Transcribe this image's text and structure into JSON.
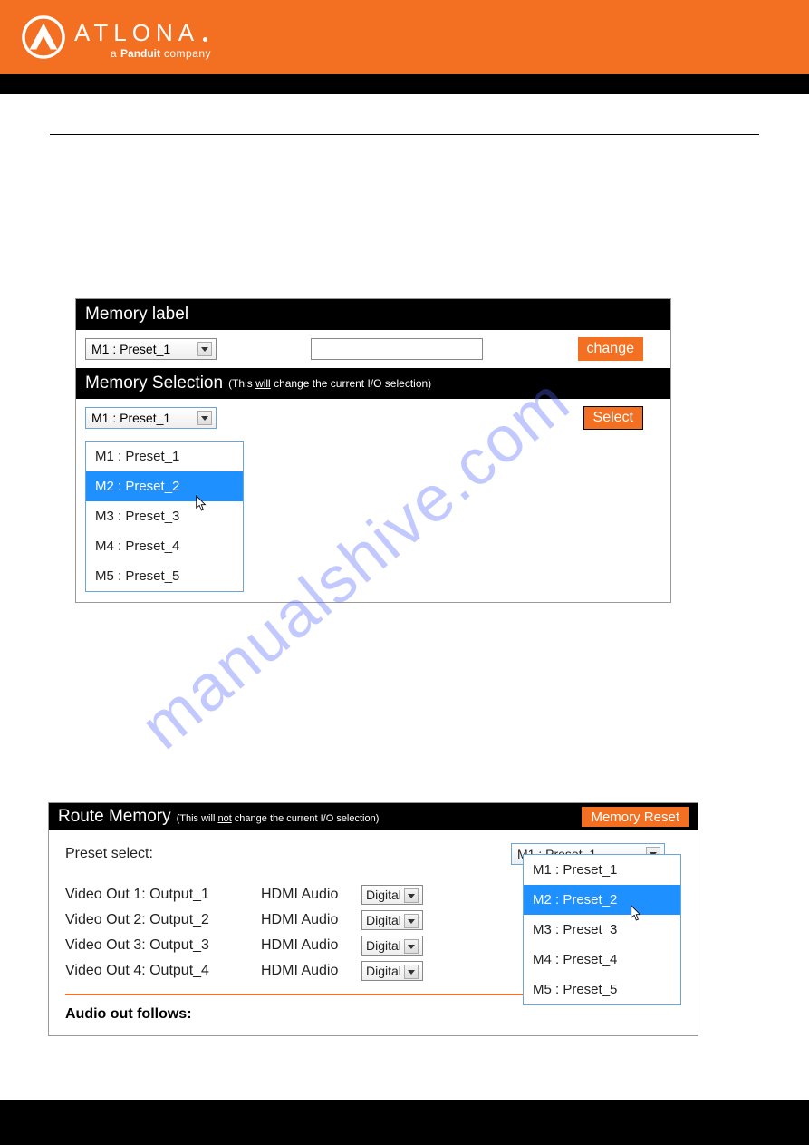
{
  "brand": {
    "name": "ATLONA",
    "tagline_prefix": "a ",
    "tagline_bold": "Panduit",
    "tagline_suffix": " company"
  },
  "watermark": "manualshive.com",
  "panel1": {
    "memory_label_title": "Memory label",
    "memory_label_selected": "M1 : Preset_1",
    "change_btn": "change",
    "memory_selection_title": "Memory Selection",
    "memory_selection_note_before": "(This ",
    "memory_selection_note_underline": "will",
    "memory_selection_note_after": " change the current I/O selection)",
    "memory_selection_selected": "M1 : Preset_1",
    "select_btn": "Select",
    "options": [
      "M1 : Preset_1",
      "M2 : Preset_2",
      "M3 : Preset_3",
      "M4 : Preset_4",
      "M5 : Preset_5"
    ],
    "highlight_index": 1
  },
  "panel2": {
    "title": "Route Memory",
    "note_before": "(This will ",
    "note_underline": "not",
    "note_after": " change the current I/O selection)",
    "memory_reset_btn": "Memory Reset",
    "preset_label": "Preset select:",
    "preset_selected": "M1 : Preset_1",
    "rows": [
      {
        "out": "Video Out 1: Output_1",
        "hdmi": "HDMI Audio",
        "val": "Digital"
      },
      {
        "out": "Video Out 2: Output_2",
        "hdmi": "HDMI Audio",
        "val": "Digital"
      },
      {
        "out": "Video Out 3: Output_3",
        "hdmi": "HDMI Audio",
        "val": "Digital"
      },
      {
        "out": "Video Out 4: Output_4",
        "hdmi": "HDMI Audio",
        "val": "Digital"
      }
    ],
    "audio_follows": "Audio out follows:",
    "options": [
      "M1 : Preset_1",
      "M2 : Preset_2",
      "M3 : Preset_3",
      "M4 : Preset_4",
      "M5 : Preset_5"
    ],
    "highlight_index": 1
  }
}
